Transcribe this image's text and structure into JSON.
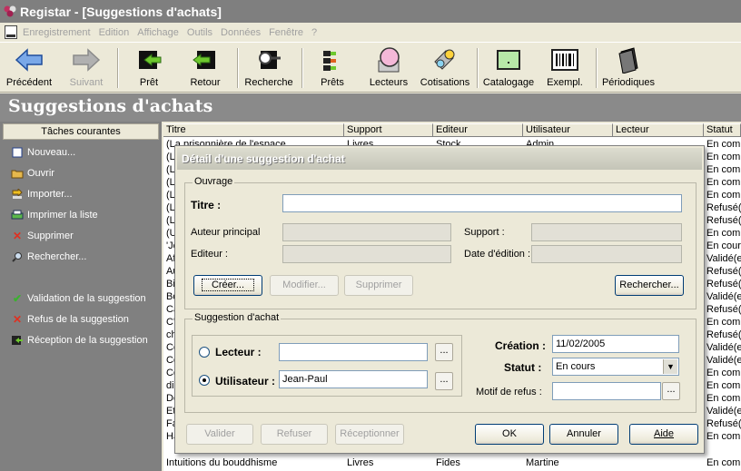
{
  "window": {
    "title": "Registar - [Suggestions d'achats]",
    "icon": "registar-app-icon"
  },
  "menu": {
    "items": [
      "Enregistrement",
      "Edition",
      "Affichage",
      "Outils",
      "Données",
      "Fenêtre",
      "?"
    ]
  },
  "toolbar": {
    "precedent": "Précédent",
    "suivant": "Suivant",
    "pret": "Prêt",
    "retour": "Retour",
    "recherche": "Recherche",
    "prets": "Prêts",
    "lecteurs": "Lecteurs",
    "cotisations": "Cotisations",
    "catalogage": "Catalogage",
    "exempl": "Exempl.",
    "periodiques": "Périodiques"
  },
  "page_title": "Suggestions d'achats",
  "sidebar": {
    "header": "Tâches courantes",
    "tasks": [
      "Nouveau...",
      "Ouvrir",
      "Importer...",
      "Imprimer la liste",
      "Supprimer",
      "Rechercher..."
    ],
    "actions": [
      "Validation de la suggestion",
      "Refus de la suggestion",
      "Réception de la suggestion"
    ]
  },
  "grid": {
    "columns": [
      "Titre",
      "Support",
      "Editeur",
      "Utilisateur",
      "Lecteur",
      "Statut"
    ],
    "first_row": [
      "(La prisonnière de l'espace",
      "Livres",
      "Stock",
      "Admin",
      "",
      "En comm"
    ],
    "titles": [
      "(L",
      "(L",
      "(L",
      "(L",
      "(L",
      "(L",
      "(U",
      "'Je",
      "Af",
      "Au",
      "Bi",
      "Bo",
      "Ca",
      "C'",
      "ch",
      "Co",
      "Co",
      "Co",
      "di",
      "De",
      "Et",
      "Fa",
      "Ha"
    ],
    "statuses": [
      "En comm",
      "En comm",
      "En comm",
      "En comm",
      "Refusé(",
      "Refusé(",
      "En comm",
      "En cour",
      "Validé(e",
      "Refusé(",
      "Refusé(",
      "Validé(e",
      "Refusé(",
      "En comm",
      "Refusé(",
      "Validé(e",
      "Validé(e",
      "En comm",
      "En comm",
      "En comm",
      "Validé(e",
      "Refusé(",
      "En comm"
    ],
    "last_row": [
      "Intuitions du bouddhisme",
      "Livres",
      "Fides",
      "Martine",
      "",
      "En comm"
    ]
  },
  "dialog": {
    "title": "Détail d'une suggestion d'achat",
    "ouvrage": {
      "legend": "Ouvrage",
      "titre_label": "Titre :",
      "titre_value": "",
      "auteur_label": "Auteur principal",
      "editeur_label": "Editeur :",
      "support_label": "Support :",
      "date_label": "Date d'édition :",
      "creer": "Créer...",
      "modifier": "Modifier...",
      "supprimer": "Supprimer",
      "rechercher": "Rechercher..."
    },
    "suggestion": {
      "legend": "Suggestion d'achat",
      "lecteur_label": "Lecteur :",
      "lecteur_value": "",
      "utilisateur_label": "Utilisateur :",
      "utilisateur_value": "Jean-Paul",
      "selected_radio": "utilisateur",
      "creation_label": "Création :",
      "creation_value": "11/02/2005",
      "statut_label": "Statut :",
      "statut_value": "En cours",
      "motif_label": "Motif de refus :",
      "motif_value": "",
      "ellipsis": "..."
    },
    "buttons": {
      "valider": "Valider",
      "refuser": "Refuser",
      "receptionner": "Réceptionner",
      "ok": "OK",
      "annuler": "Annuler",
      "aide": "Aide"
    }
  }
}
